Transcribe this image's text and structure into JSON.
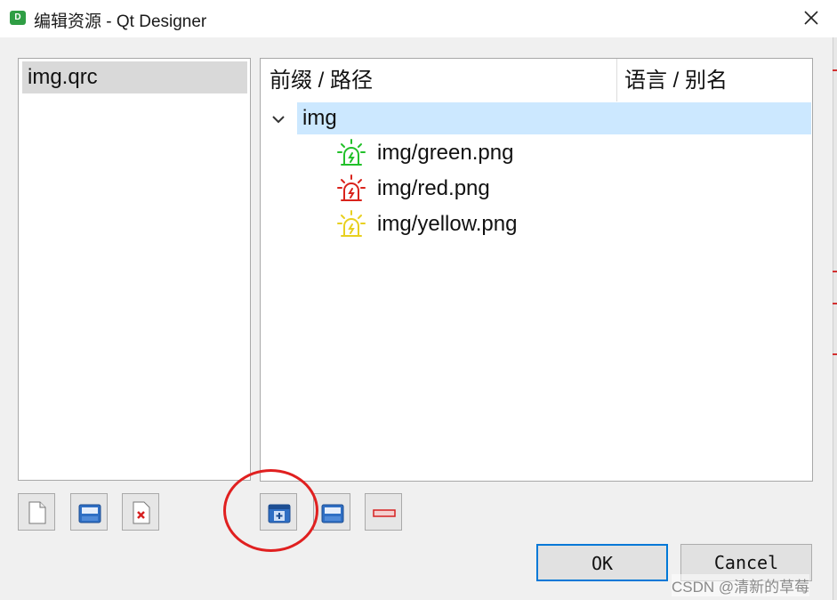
{
  "window": {
    "title": "编辑资源 - Qt Designer",
    "app_icon_letter": "D"
  },
  "files": [
    {
      "label": "img.qrc",
      "selected": true
    }
  ],
  "tree": {
    "headers": {
      "prefix_path": "前缀 / 路径",
      "language_alias": "语言 / 别名"
    },
    "prefix": {
      "label": "img",
      "expanded": true,
      "selected": true
    },
    "resources": [
      {
        "label": "img/green.png",
        "icon": "green-alarm-light-icon",
        "color": "#22c02a"
      },
      {
        "label": "img/red.png",
        "icon": "red-alarm-light-icon",
        "color": "#d9231c"
      },
      {
        "label": "img/yellow.png",
        "icon": "yellow-alarm-light-icon",
        "color": "#e8d020"
      }
    ]
  },
  "toolbar_icons": {
    "file_tools": [
      "new-file-icon",
      "open-file-icon",
      "remove-file-icon"
    ],
    "resource_tools": [
      "add-prefix-icon",
      "add-files-icon",
      "remove-icon"
    ]
  },
  "buttons": {
    "ok": "OK",
    "cancel": "Cancel"
  },
  "annotation": {
    "highlight_color": "#e02020"
  },
  "watermark": "CSDN @清新的草莓"
}
